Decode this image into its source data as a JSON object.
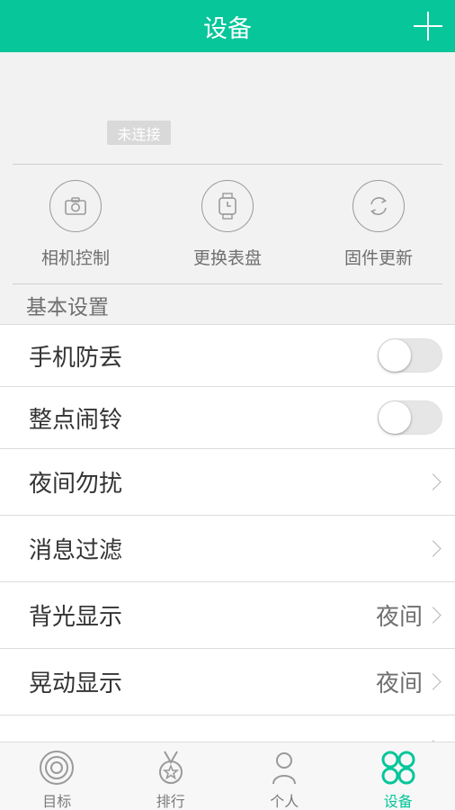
{
  "header": {
    "title": "设备",
    "add_icon": "plus-icon"
  },
  "device": {
    "status": "未连接"
  },
  "quick_actions": [
    {
      "label": "相机控制",
      "icon": "camera-icon"
    },
    {
      "label": "更换表盘",
      "icon": "watch-icon"
    },
    {
      "label": "固件更新",
      "icon": "refresh-icon"
    }
  ],
  "section": {
    "title": "基本设置"
  },
  "settings": [
    {
      "label": "手机防丢",
      "type": "toggle",
      "on": false
    },
    {
      "label": "整点闹铃",
      "type": "toggle",
      "on": false
    },
    {
      "label": "夜间勿扰",
      "type": "link"
    },
    {
      "label": "消息过滤",
      "type": "link"
    },
    {
      "label": "背光显示",
      "type": "link",
      "value": "夜间"
    },
    {
      "label": "晃动显示",
      "type": "link",
      "value": "夜间"
    }
  ],
  "tabs": [
    {
      "label": "目标",
      "icon": "target-icon",
      "active": false
    },
    {
      "label": "排行",
      "icon": "medal-icon",
      "active": false
    },
    {
      "label": "个人",
      "icon": "person-icon",
      "active": false
    },
    {
      "label": "设备",
      "icon": "clover-icon",
      "active": true
    }
  ],
  "colors": {
    "accent": "#06c69a",
    "background": "#f2f2f2"
  }
}
